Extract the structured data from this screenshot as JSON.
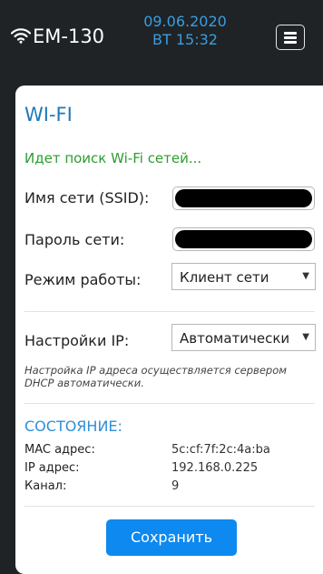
{
  "header": {
    "device_name": "EM-130",
    "date": "09.06.2020",
    "day_time": "ВТ 15:32",
    "icons": {
      "wifi": "wifi-icon",
      "menu": "hamburger-menu-icon"
    }
  },
  "wifi": {
    "title": "WI-FI",
    "search_status": "Идет поиск Wi-Fi сетей...",
    "ssid_label": "Имя сети (SSID):",
    "ssid_value": "",
    "password_label": "Пароль сети:",
    "password_value": "",
    "mode_label": "Режим работы:",
    "mode_value": "Клиент сети",
    "ip_settings_label": "Настройки IP:",
    "ip_settings_value": "Автоматически",
    "ip_note": "Настройка IP адреса осуществляется сервером DHCP автоматически."
  },
  "status": {
    "title": "СОСТОЯНИЕ:",
    "rows": [
      {
        "key": "MAC адрес:",
        "value": "5c:cf:7f:2c:4a:ba"
      },
      {
        "key": "IP адрес:",
        "value": "192.168.0.225"
      },
      {
        "key": "Канал:",
        "value": "9"
      }
    ]
  },
  "save_label": "Сохранить",
  "colors": {
    "background": "#1f2326",
    "accent_blue": "#1e78b8",
    "search_green": "#2e9c32",
    "button_blue": "#0d89f0"
  }
}
